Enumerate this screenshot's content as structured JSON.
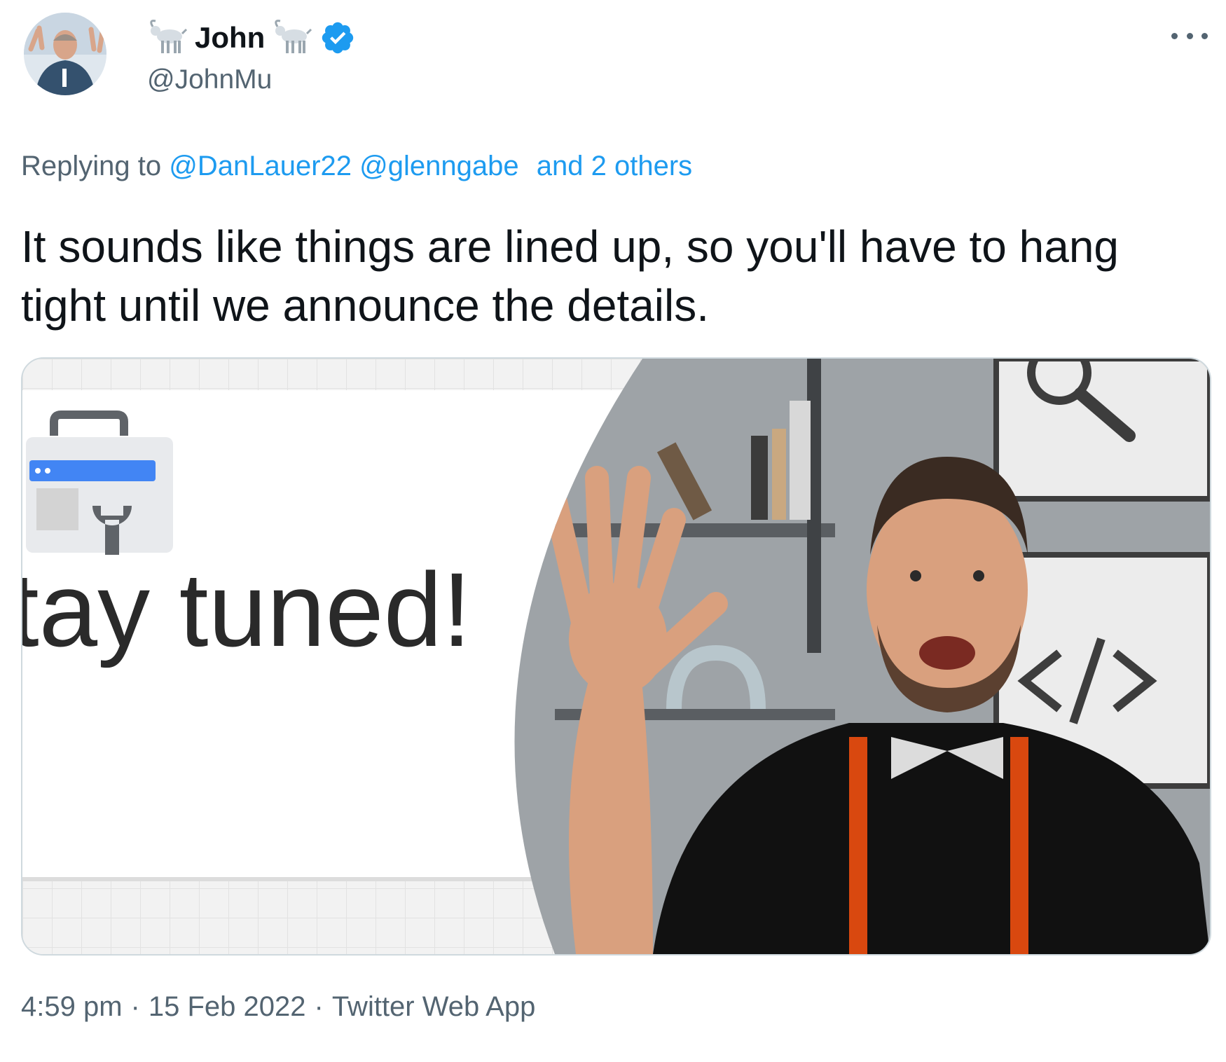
{
  "author": {
    "display_name": "John",
    "handle": "@JohnMu",
    "verified": true,
    "name_emoji_icon": "goat-icon"
  },
  "reply": {
    "prefix": "Replying to",
    "mentions": [
      "@DanLauer22",
      "@glenngabe"
    ],
    "others": "and 2 others"
  },
  "tweet": {
    "text": "It sounds like things are lined up, so you'll have to hang tight until we announce the details."
  },
  "media": {
    "overlay_text": "tay tuned!"
  },
  "meta": {
    "time": "4:59 pm",
    "date": "15 Feb 2022",
    "source": "Twitter Web App"
  },
  "colors": {
    "link": "#1d9bf0",
    "secondary": "#536471",
    "primary": "#0f1419",
    "verified": "#1d9bf0",
    "suspenders": "#d9480f"
  }
}
